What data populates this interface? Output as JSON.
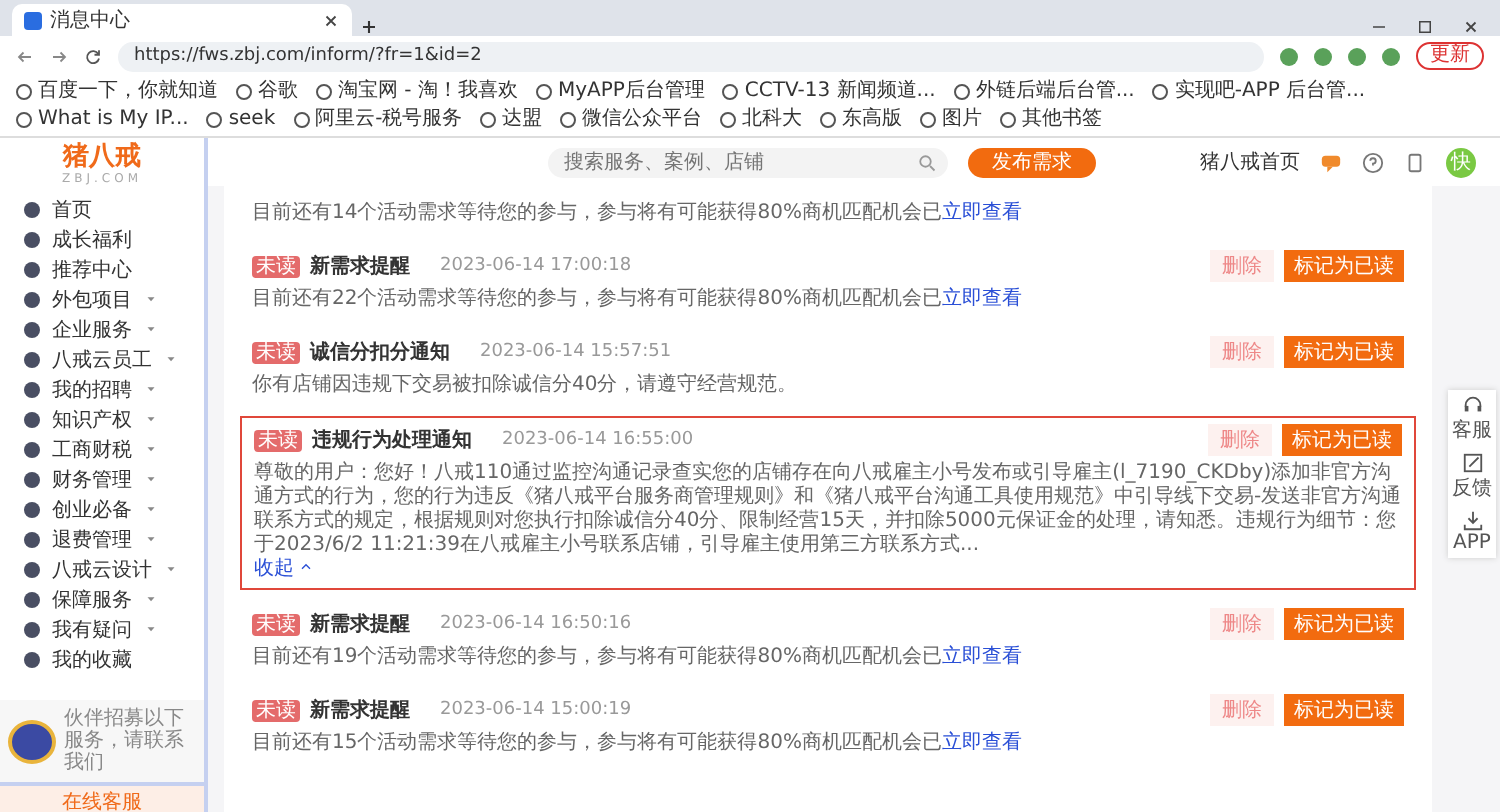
{
  "browser": {
    "tab_title": "消息中心",
    "url": "https://fws.zbj.com/inform/?fr=1&id=2",
    "update_button": "更新",
    "bookmarks": [
      "百度一下，你就知道",
      "谷歌",
      "淘宝网 - 淘！我喜欢",
      "MyAPP后台管理",
      "CCTV-13 新闻频道...",
      "外链后端后台管...",
      "实现吧-APP 后台管...",
      "What is My IP...",
      "seek",
      "阿里云-税号服务",
      "达盟",
      "微信公众平台",
      "北科大",
      "东高版",
      "图片",
      "其他书签"
    ]
  },
  "sidebar": {
    "logo": "猪八戒",
    "logo_sub": "ZBJ.COM",
    "items": [
      {
        "label": "首页",
        "expandable": false
      },
      {
        "label": "成长福利",
        "expandable": false
      },
      {
        "label": "推荐中心",
        "expandable": false
      },
      {
        "label": "外包项目",
        "expandable": true
      },
      {
        "label": "企业服务",
        "expandable": true
      },
      {
        "label": "八戒云员工",
        "expandable": true
      },
      {
        "label": "我的招聘",
        "expandable": true
      },
      {
        "label": "知识产权",
        "expandable": true
      },
      {
        "label": "工商财税",
        "expandable": true
      },
      {
        "label": "财务管理",
        "expandable": true
      },
      {
        "label": "创业必备",
        "expandable": true
      },
      {
        "label": "退费管理",
        "expandable": true
      },
      {
        "label": "八戒云设计",
        "expandable": true
      },
      {
        "label": "保障服务",
        "expandable": true
      },
      {
        "label": "我有疑问",
        "expandable": true
      },
      {
        "label": "我的收藏",
        "expandable": false
      }
    ],
    "promo_text": "伙伴招募以下服务，请联系我们",
    "bottom_button": "在线客服"
  },
  "header": {
    "search_placeholder": "搜索服务、案例、店铺",
    "publish_button": "发布需求",
    "home_link": "猪八戒首页",
    "avatar_text": "快"
  },
  "messages": [
    {
      "kind": "partial",
      "text": "目前还有14个活动需求等待您的参与，参与将有可能获得80%商机匹配机会已",
      "link": "立即查看"
    },
    {
      "kind": "full",
      "tag": "未读",
      "title": "新需求提醒",
      "time": "2023-06-14 17:00:18",
      "text": "目前还有22个活动需求等待您的参与，参与将有可能获得80%商机匹配机会已",
      "link": "立即查看",
      "delete_button": "删除",
      "read_button": "标记为已读",
      "highlighted": false
    },
    {
      "kind": "full",
      "tag": "未读",
      "title": "诚信分扣分通知",
      "time": "2023-06-14 15:57:51",
      "text": "你有店铺因违规下交易被扣除诚信分40分，请遵守经营规范。",
      "delete_button": "删除",
      "read_button": "标记为已读",
      "highlighted": false
    },
    {
      "kind": "full",
      "tag": "未读",
      "title": "违规行为处理通知",
      "time": "2023-06-14 16:55:00",
      "text": "尊敬的用户：您好！八戒110通过监控沟通记录查实您的店铺存在向八戒雇主小号发布或引导雇主(l_7190_CKDby)添加非官方沟通方式的行为，您的行为违反《猪八戒平台服务商管理规则》和《猪八戒平台沟通工具使用规范》中引导线下交易-发送非官方沟通联系方式的规定，根据规则对您执行扣除诚信分40分、限制经营15天，并扣除5000元保证金的处理，请知悉。违规行为细节：您于2023/6/2 11:21:39在八戒雇主小号联系店铺，引导雇主使用第三方联系方式...",
      "collapse_link": "收起",
      "delete_button": "删除",
      "read_button": "标记为已读",
      "highlighted": true
    },
    {
      "kind": "full",
      "tag": "未读",
      "title": "新需求提醒",
      "time": "2023-06-14 16:50:16",
      "text": "目前还有19个活动需求等待您的参与，参与将有可能获得80%商机匹配机会已",
      "link": "立即查看",
      "delete_button": "删除",
      "read_button": "标记为已读",
      "highlighted": false
    },
    {
      "kind": "full",
      "tag": "未读",
      "title": "新需求提醒",
      "time": "2023-06-14 15:00:19",
      "text": "目前还有15个活动需求等待您的参与，参与将有可能获得80%商机匹配机会已",
      "link": "立即查看",
      "delete_button": "删除",
      "read_button": "标记为已读",
      "highlighted": false
    }
  ],
  "side_tools": [
    {
      "kind": "headset",
      "label": "客服"
    },
    {
      "kind": "edit",
      "label": "反馈"
    },
    {
      "kind": "download",
      "label": "APP"
    }
  ]
}
